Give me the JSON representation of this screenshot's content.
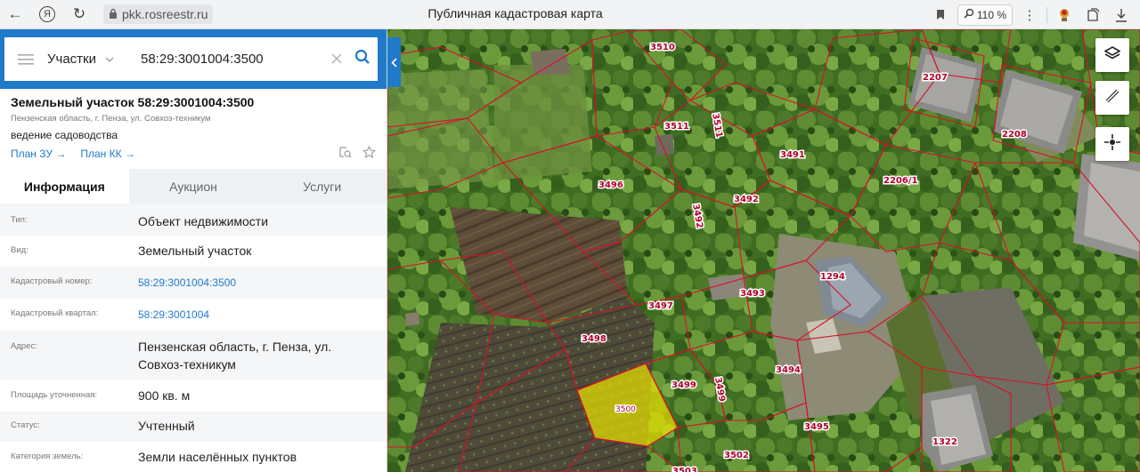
{
  "browser": {
    "back_icon": "←",
    "yandex_icon": "Я",
    "reload_icon": "↻",
    "url": "pkk.rosreestr.ru",
    "title": "Публичная кадастровая карта",
    "zoom": "110 %",
    "menu_icon": "⋮"
  },
  "search": {
    "type_label": "Участки",
    "query": "58:29:3001004:3500"
  },
  "object": {
    "title": "Земельный участок 58:29:3001004:3500",
    "address_short": "Пензенская область, г. Пенза, ул. Совхоз-техникум",
    "use": "ведение садоводства",
    "plan_zu": "План ЗУ →",
    "plan_kk": "План КК →"
  },
  "tabs": [
    {
      "label": "Информация"
    },
    {
      "label": "Аукцион"
    },
    {
      "label": "Услуги"
    }
  ],
  "info": [
    {
      "label": "Тип:",
      "value": "Объект недвижимости"
    },
    {
      "label": "Вид:",
      "value": "Земельный участок"
    },
    {
      "label": "Кадастровый номер:",
      "value": "58:29:3001004:3500"
    },
    {
      "label": "Кадастровый квартал:",
      "value": "58:29:3001004"
    },
    {
      "label": "Адрес:",
      "value": "Пензенская область, г. Пенза, ул. Совхоз-техникум"
    },
    {
      "label": "Площадь уточненная:",
      "value": "900 кв. м"
    },
    {
      "label": "Статус:",
      "value": "Учтенный"
    },
    {
      "label": "Категория земель:",
      "value": "Земли населённых пунктов"
    }
  ],
  "map": {
    "parcels": [
      "3510",
      "3511",
      "3511",
      "3496",
      "3491",
      "3492",
      "3492",
      "3493",
      "3497",
      "3498",
      "3499",
      "3499",
      "3500",
      "3494",
      "3495",
      "3502",
      "3503",
      "1294",
      "2207",
      "2208",
      "2206/1",
      "1322"
    ],
    "selected_color": "#e8e000",
    "boundary_color": "#d8102a"
  }
}
